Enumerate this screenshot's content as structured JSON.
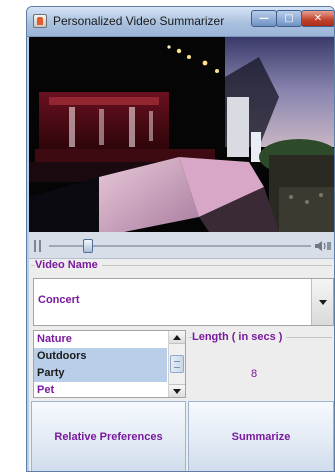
{
  "window": {
    "title": "Personalized Video Summarizer",
    "controls": {
      "minimize": "—",
      "maximize": "□",
      "close": "✕"
    }
  },
  "player": {
    "scene": "concert-stage-video-frame",
    "seek_position_percent": 15,
    "icons": {
      "play": "pause-icon",
      "volume": "volume-icon"
    }
  },
  "video_name": {
    "legend": "Video Name",
    "selected": "Concert"
  },
  "tags": {
    "items": [
      {
        "label": "Nature",
        "selected": false
      },
      {
        "label": "Outdoors",
        "selected": true
      },
      {
        "label": "Party",
        "selected": true
      },
      {
        "label": "Pet",
        "selected": false
      }
    ]
  },
  "length": {
    "legend": "Length ( in secs )",
    "value": "8"
  },
  "buttons": {
    "relative_preferences": "Relative Preferences",
    "summarize": "Summarize"
  },
  "colors": {
    "accent_text": "#7a1a9e",
    "selection": "#b9cfe9",
    "window_frame": "#9bb5d8",
    "close_button": "#c1412a"
  }
}
